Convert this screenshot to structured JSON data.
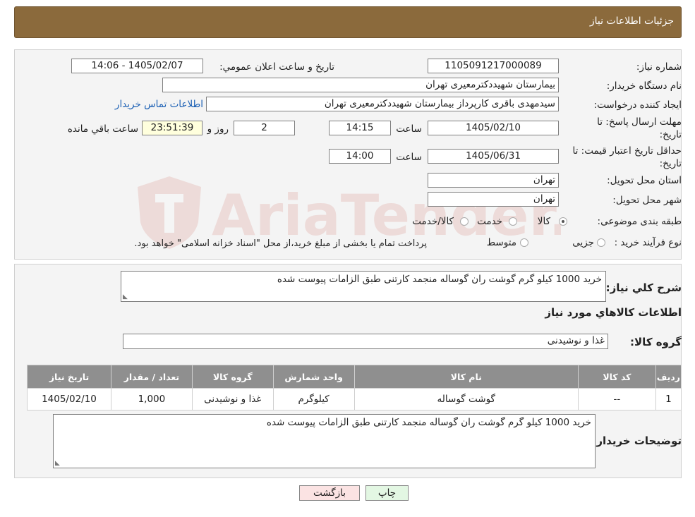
{
  "header": {
    "title": "جزئیات اطلاعات نیاز"
  },
  "watermark": {
    "text": "AriaTender.neT"
  },
  "fields": {
    "need_number_label": "شماره نیاز:",
    "need_number": "1105091217000089",
    "announce_label": "تاريخ و ساعت اعلان عمومي:",
    "announce_value": "1405/02/07 - 14:06",
    "buyer_org_label": "نام دستگاه خریدار:",
    "buyer_org": "بیمارستان شهیددکترمعیری تهران",
    "creator_label": "ایجاد کننده درخواست:",
    "creator": "سیدمهدی باقری کارپرداز بیمارستان شهیددکترمعیری تهران",
    "contact_link": "اطلاعات تماس خریدار",
    "deadline_label": "مهلت ارسال پاسخ: تا تاریخ:",
    "deadline_date": "1405/02/10",
    "time_label": "ساعت",
    "deadline_time": "14:15",
    "days_value": "2",
    "days_label": "روز و",
    "remaining_time": "23:51:39",
    "remaining_label": "ساعت باقي مانده",
    "validity_label": "حداقل تاریخ اعتبار قیمت: تا تاریخ:",
    "validity_date": "1405/06/31",
    "validity_time": "14:00",
    "province_label": "استان محل تحویل:",
    "province": "تهران",
    "city_label": "شهر محل تحویل:",
    "city": "تهران",
    "category_label": "طبقه بندی موضوعی:",
    "category_options": [
      "کالا",
      "خدمت",
      "کالا/خدمت"
    ],
    "purchase_type_label": "نوع فرآیند خرید :",
    "purchase_options": [
      "جزیی",
      "متوسط"
    ],
    "purchase_note": "پرداخت تمام یا بخشی از مبلغ خرید،از محل \"اسناد خزانه اسلامی\" خواهد بود."
  },
  "description": {
    "label": "شرح کلي نياز:",
    "text": "خرید 1000 کیلو گرم گوشت ران گوساله منجمد کارتنی طبق الزامات پیوست شده"
  },
  "goods": {
    "section_title": "اطلاعات کالاهاي مورد نياز",
    "group_label": "گروه کالا:",
    "group_value": "غذا و نوشیدنی",
    "columns": [
      "رديف",
      "کد کالا",
      "نام کالا",
      "واحد شمارش",
      "گروه کالا",
      "تعداد / مقدار",
      "تاريخ نياز"
    ],
    "rows": [
      [
        "1",
        "--",
        "گوشت گوساله",
        "کیلوگرم",
        "غذا و نوشیدنی",
        "1,000",
        "1405/02/10"
      ]
    ]
  },
  "buyer_notes": {
    "label": "توضیحات خریدار:",
    "text": "خرید 1000 کیلو گرم گوشت ران گوساله منجمد کارتنی طبق الزامات پیوست شده"
  },
  "buttons": {
    "print": "چاپ",
    "back": "بازگشت"
  },
  "colors": {
    "header_bg": "#8b6a3c",
    "table_header_bg": "#8f8f8f",
    "link": "#1a5fb4",
    "back_button_bg": "#fbe3e3",
    "print_button_bg": "#e3f7e3",
    "watermark": "#c0392b"
  }
}
